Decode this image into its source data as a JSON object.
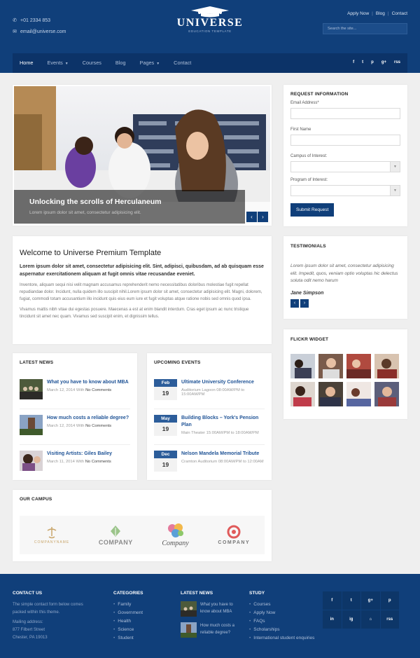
{
  "header": {
    "phone": "+01 2334 853",
    "email": "email@universe.com",
    "logo_name": "UNIVERSE",
    "logo_tagline": "EDUCATION TEMPLATE",
    "top_links": [
      "Apply Now",
      "Blog",
      "Contact"
    ],
    "search_placeholder": "Search the site...",
    "nav": [
      {
        "label": "Home",
        "active": true
      },
      {
        "label": "Events",
        "dropdown": true
      },
      {
        "label": "Courses"
      },
      {
        "label": "Blog"
      },
      {
        "label": "Pages",
        "dropdown": true
      },
      {
        "label": "Contact"
      }
    ],
    "social": [
      "f",
      "t",
      "p",
      "g+",
      "rss"
    ]
  },
  "slider": {
    "title": "Unlocking the scrolls of Herculaneum",
    "subtitle": "Lorem ipsum dolor sit amet, consectetur adipisicing elit."
  },
  "request": {
    "title": "REQUEST INFORMATION",
    "email_label": "Email Address*",
    "first_name_label": "First Name",
    "campus_label": "Campus of Interest:",
    "program_label": "Program of Interest:",
    "submit_label": "Submit Request"
  },
  "welcome": {
    "title": "Welcome to Universe Premium Template",
    "lead": "Lorem ipsum dolor sit amet, consectetur adipisicing elit. Sint, adipisci, quibusdam, ad ab quisquam esse aspernatur exercitationem aliquam at fugit omnis vitae recusandae eveniet.",
    "p1": "Inventore, aliquam sequi nisi velit magnam accusamus reprehenderit nemo necessitatibus doloribus molestiae fugit repellat repudiandae dolor. Incidunt, nulla quidem illo suscipit nihil.Lorem ipsum dolor sit amet, consectetur adipisicing elit. Magni, dolorem, fugiat, commodi totam accusantium illo incidunt quis eius eum iure et fugit voluptas atque ratione nobis sed omnis quod ipsa.",
    "p2": "Vivamus mattis nibh vitae dui egestas posuere. Maecenas a est at enim blandit interdum. Cras eget ipsum ac nunc tristique tincidunt sit amet nec quam. Vivamus sed suscipit enim, et dignissim tellus."
  },
  "testimonials": {
    "title": "TESTIMONIALS",
    "quote": "Lorem ipsum dolor sit amet, consectetur adipisicing elit. Impedit, quos, veniam optio voluptas hic delectus soluta odit nemo harum",
    "name": "Jane Simpson"
  },
  "flickr": {
    "title": "FLICKR WIDGET"
  },
  "news": {
    "title": "LATEST NEWS",
    "items": [
      {
        "title": "What you have to know about MBA",
        "date": "March 12, 2014 With",
        "comments": "No Comments"
      },
      {
        "title": "How much costs a reliable degree?",
        "date": "March 12, 2014 With",
        "comments": "No Comments"
      },
      {
        "title": "Visiting Artists: Giles Bailey",
        "date": "March 11, 2014 With",
        "comments": "No Comments"
      }
    ]
  },
  "events": {
    "title": "UPCOMING EVENTS",
    "items": [
      {
        "month": "Feb",
        "day": "19",
        "title": "Ultimate University Conference",
        "meta": "Auditorium Lagoon 08:00AM/PM to 15:00AM/PM"
      },
      {
        "month": "May",
        "day": "19",
        "title": "Building Blocks – York's Pension Plan",
        "meta": "Main Theater 15:00AM/PM to 18:00AM/PM"
      },
      {
        "month": "Dec",
        "day": "19",
        "title": "Nelson Mandela Memorial Tribute",
        "meta": "Cramton Auditorium 08:00AM/PM to 12:00AM"
      }
    ]
  },
  "campus": {
    "title": "OUR CAMPUS",
    "logos": [
      "COMPANYNAME",
      "COMPANY",
      "Company",
      "COMPANY"
    ]
  },
  "footer": {
    "contact": {
      "title": "CONTACT US",
      "text": "The simple contact form below comes packed within this theme.",
      "address_label": "Mailing address:",
      "street": "877 Filbert Street",
      "city": "Chester, PA 19013"
    },
    "categories": {
      "title": "CATEGORIES",
      "items": [
        "Family",
        "Government",
        "Health",
        "Science",
        "Student"
      ]
    },
    "latest_news": {
      "title": "LATEST NEWS",
      "items": [
        "What you have to know about MBA",
        "How much costs a reliable degree?"
      ]
    },
    "study": {
      "title": "STUDY",
      "items": [
        "Courses",
        "Apply Now",
        "FAQs",
        "Scholarships",
        "International student enquiries"
      ]
    },
    "social": [
      "f",
      "t",
      "g+",
      "p",
      "in",
      "ig",
      "⌂",
      "rss"
    ]
  }
}
